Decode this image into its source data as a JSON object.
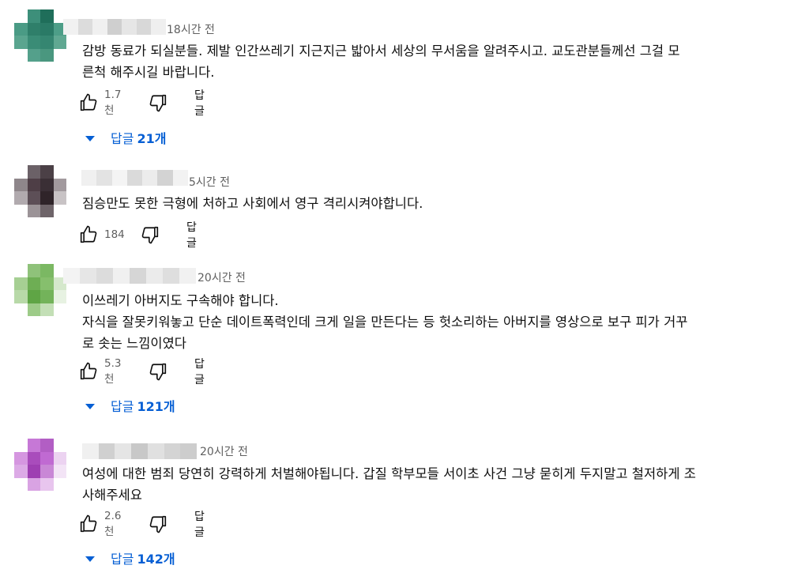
{
  "comments": [
    {
      "time": "18시간 전",
      "text_lines": [
        "감방 동료가 되실분들. 제발 인간쓰레기 지근지근 밟아서 세상의 무서움을 알려주시고. 교도관분들께선 그걸 모",
        "른척 해주시길 바랍니다."
      ],
      "likes": "1.7천",
      "reply_label": "답글",
      "replies_prefix": "답글",
      "replies_count": "21개",
      "avatar_colors": [
        "#ffffff",
        "#3d8f7a",
        "#1f6e5a",
        "#ffffff",
        "#4a9b85",
        "#2f7f6a",
        "#2a7a66",
        "#4d9e88",
        "#5aa58f",
        "#3a8c76",
        "#358671",
        "#60a892",
        "#ffffff",
        "#54a08b",
        "#4a977f",
        "#ffffff"
      ]
    },
    {
      "time": "5시간 전",
      "text_lines": [
        "짐승만도 못한 극형에 처하고 사회에서 영구 격리시켜야합니다."
      ],
      "likes": "184",
      "reply_label": "답글",
      "avatar_colors": [
        "#ffffff",
        "#6b6167",
        "#4b4046",
        "#ffffff",
        "#8e868a",
        "#4e3e46",
        "#3a2f35",
        "#a29a9e",
        "#b1aaae",
        "#5d4f57",
        "#2f2429",
        "#c8c3c5",
        "#ffffff",
        "#9b9397",
        "#6e6469",
        "#ffffff"
      ]
    },
    {
      "time": "20시간 전",
      "text_lines": [
        "이쓰레기 아버지도 구속해야 합니다.",
        "자식을 잘못키워놓고 단순 데이트폭력인데 크게 일을 만든다는 등 헛소리하는 아버지를 영상으로 보구 피가 거꾸",
        "로 솟는 느낌이였다"
      ],
      "likes": "5.3천",
      "reply_label": "답글",
      "replies_prefix": "답글",
      "replies_count": "121개",
      "avatar_colors": [
        "#ffffff",
        "#8fc27a",
        "#7bb863",
        "#ffffff",
        "#a6cf93",
        "#6eae54",
        "#86bf6d",
        "#d5e8cc",
        "#b8d9a8",
        "#5fa545",
        "#73b35a",
        "#e7f2e2",
        "#ffffff",
        "#9dcb88",
        "#c3dfb6",
        "#ffffff"
      ]
    },
    {
      "time": "20시간 전",
      "text_lines": [
        "여성에 대한 범죄 당연히 강력하게 처벌해야됩니다. 갑질 학부모들 서이초 사건 그냥 묻히게 두지말고 철저하게 조",
        "사해주세요"
      ],
      "likes": "2.6천",
      "reply_label": "답글",
      "replies_prefix": "답글",
      "replies_count": "142개",
      "avatar_colors": [
        "#ffffff",
        "#c678d6",
        "#b25ec4",
        "#ffffff",
        "#d596e0",
        "#a94cbc",
        "#c06ad2",
        "#ecd3f1",
        "#dcaae6",
        "#9e3fb2",
        "#c987d6",
        "#f3e4f6",
        "#ffffff",
        "#d9a3e3",
        "#e8c5ee",
        "#ffffff"
      ]
    }
  ]
}
